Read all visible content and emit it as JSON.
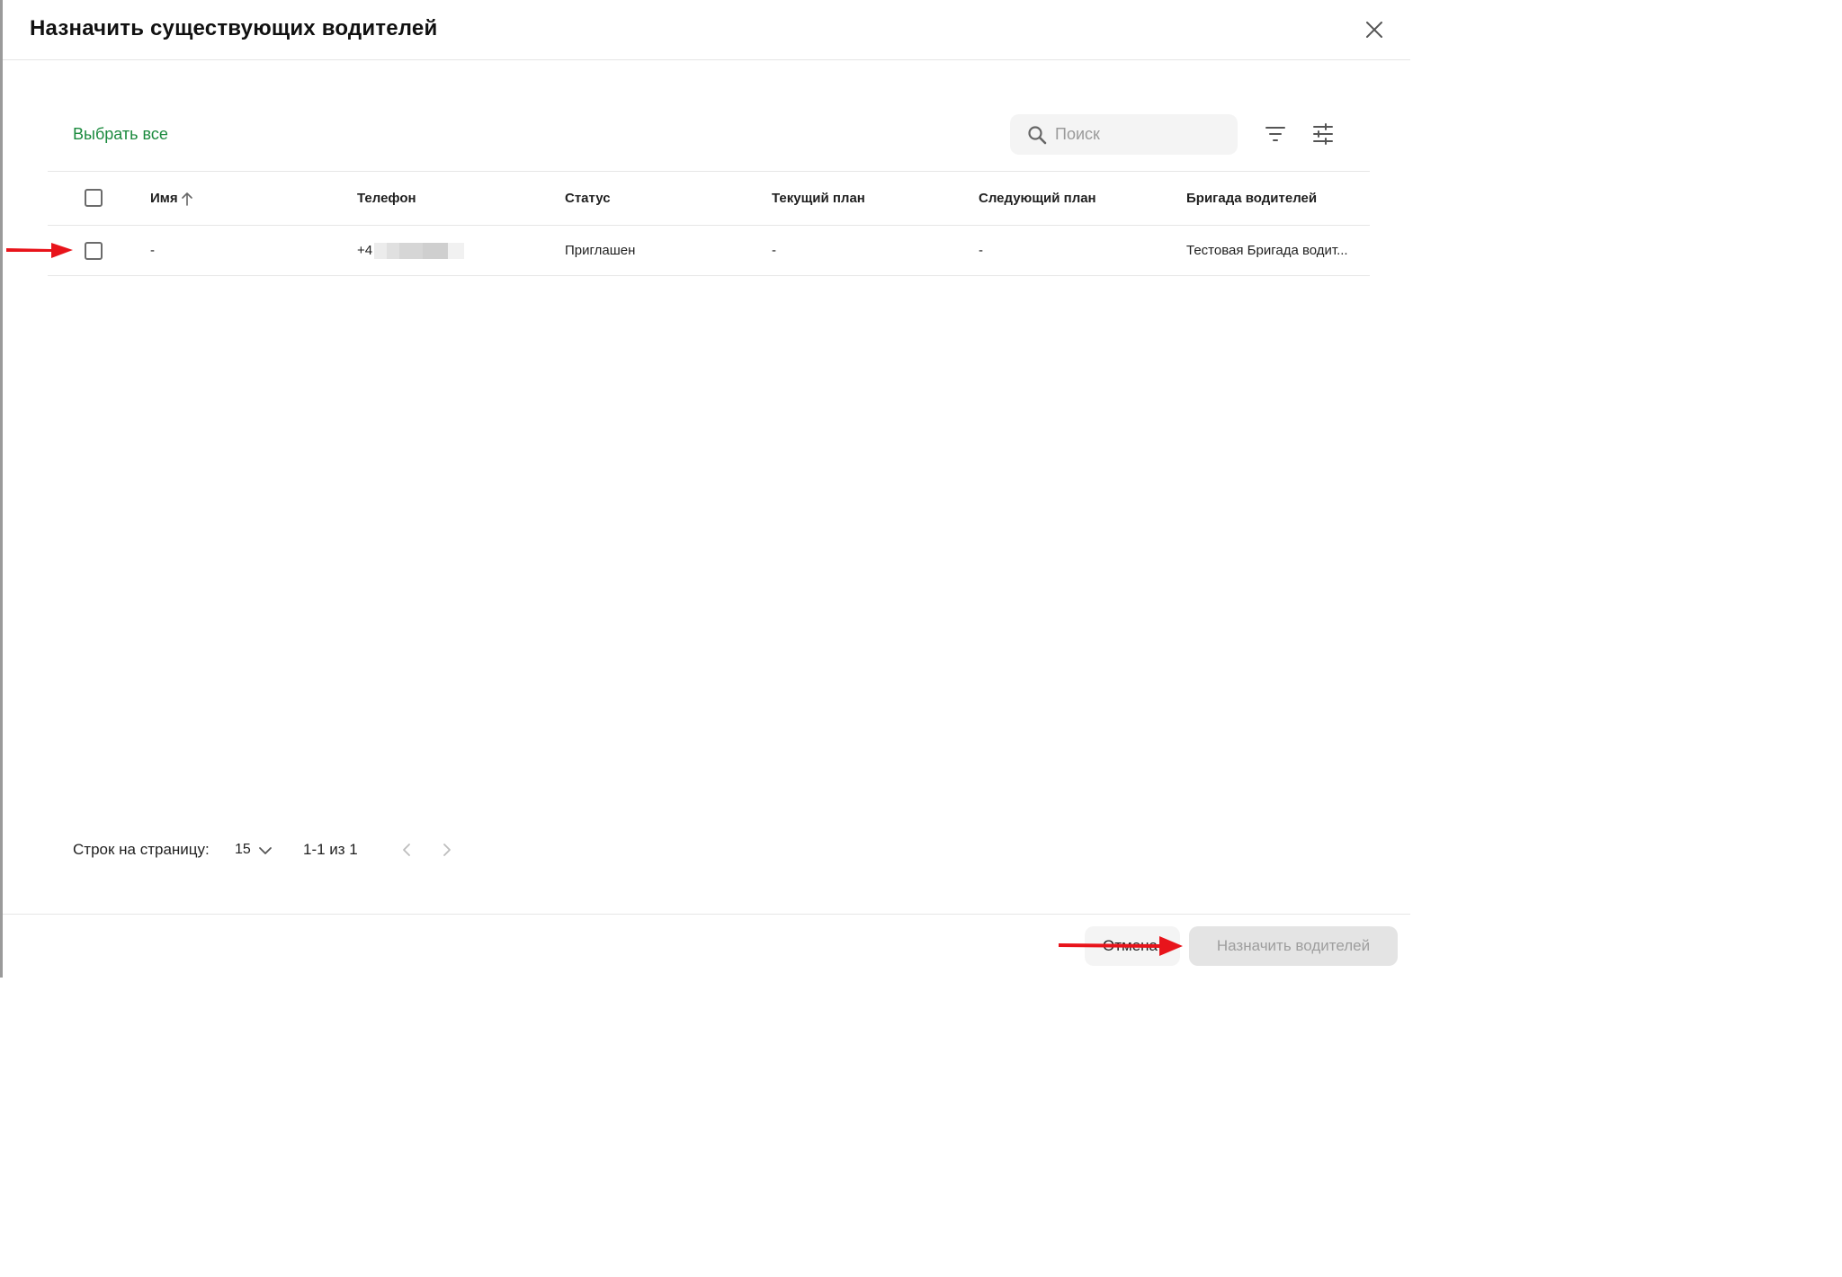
{
  "dialog": {
    "title": "Назначить существующих водителей"
  },
  "toolbar": {
    "select_all_label": "Выбрать все",
    "search_placeholder": "Поиск"
  },
  "table": {
    "columns": [
      {
        "key": "name",
        "label": "Имя",
        "sorted": "ascending"
      },
      {
        "key": "phone",
        "label": "Телефон"
      },
      {
        "key": "status",
        "label": "Статус"
      },
      {
        "key": "current_plan",
        "label": "Текущий план"
      },
      {
        "key": "next_plan",
        "label": "Следующий план"
      },
      {
        "key": "brigade",
        "label": "Бригада водителей"
      }
    ],
    "rows": [
      {
        "checked": false,
        "name": "-",
        "phone": "+4",
        "status": "Приглашен",
        "current_plan": "-",
        "next_plan": "-",
        "brigade": "Тестовая Бригада водит..."
      }
    ]
  },
  "pagination": {
    "rows_per_page_label": "Строк на страницу:",
    "rows_per_page": "15",
    "range": "1-1 из 1"
  },
  "footer": {
    "cancel_label": "Отмена",
    "assign_label": "Назначить водителей"
  },
  "colors": {
    "accent": "#1b8a3e",
    "annotation_arrow": "#e8141b"
  }
}
